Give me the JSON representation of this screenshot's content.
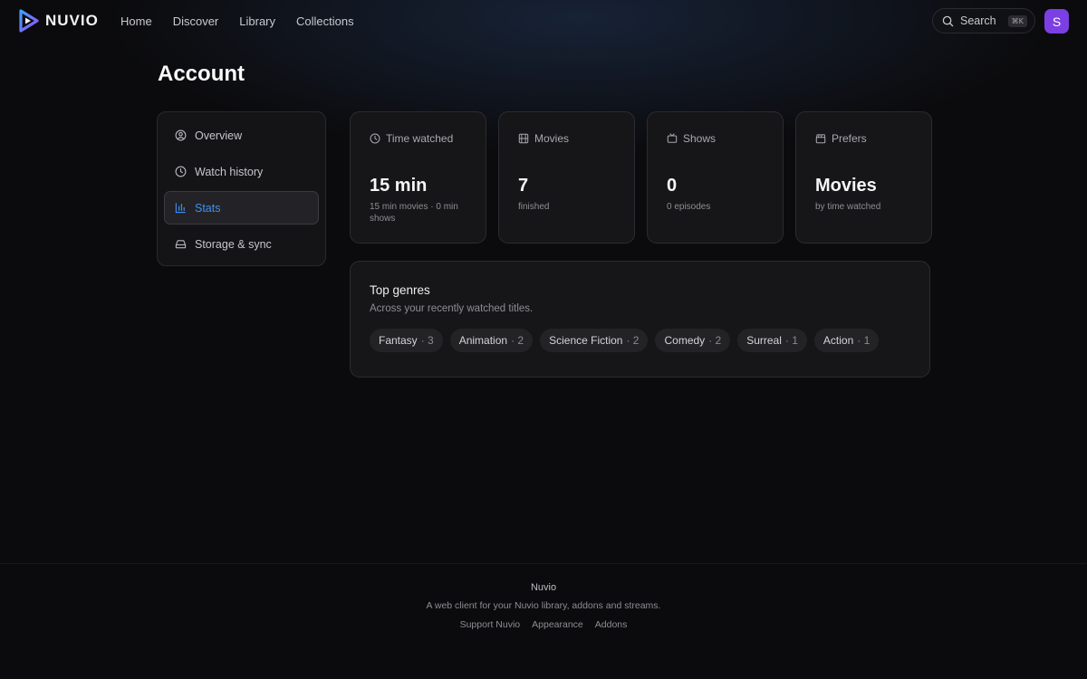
{
  "brand": {
    "name": "NUVIO",
    "accent": "#7b3fe4"
  },
  "nav": {
    "links": [
      "Home",
      "Discover",
      "Library",
      "Collections"
    ],
    "search_label": "Search",
    "search_shortcut": "⌘K",
    "avatar_initial": "S"
  },
  "page": {
    "title": "Account"
  },
  "sidebar": {
    "active": "Stats",
    "items": [
      {
        "label": "Overview",
        "icon": "user-circle-icon"
      },
      {
        "label": "Watch history",
        "icon": "clock-icon"
      },
      {
        "label": "Stats",
        "icon": "bar-chart-icon"
      },
      {
        "label": "Storage & sync",
        "icon": "hard-drive-icon"
      }
    ]
  },
  "stats": [
    {
      "label": "Time watched",
      "icon": "clock-icon",
      "value": "15 min",
      "sub": "15 min movies · 0 min shows"
    },
    {
      "label": "Movies",
      "icon": "film-icon",
      "value": "7",
      "sub": "finished"
    },
    {
      "label": "Shows",
      "icon": "tv-icon",
      "value": "0",
      "sub": "0 episodes"
    },
    {
      "label": "Prefers",
      "icon": "clapperboard-icon",
      "value": "Movies",
      "sub": "by time watched"
    }
  ],
  "genres": {
    "title": "Top genres",
    "subtitle": "Across your recently watched titles.",
    "items": [
      {
        "name": "Fantasy",
        "count": "· 3"
      },
      {
        "name": "Animation",
        "count": "· 2"
      },
      {
        "name": "Science Fiction",
        "count": "· 2"
      },
      {
        "name": "Comedy",
        "count": "· 2"
      },
      {
        "name": "Surreal",
        "count": "· 1"
      },
      {
        "name": "Action",
        "count": "· 1"
      }
    ]
  },
  "footer": {
    "title": "Nuvio",
    "description": "A web client for your Nuvio library, addons and streams.",
    "links": [
      "Support Nuvio",
      "Appearance",
      "Addons"
    ]
  }
}
